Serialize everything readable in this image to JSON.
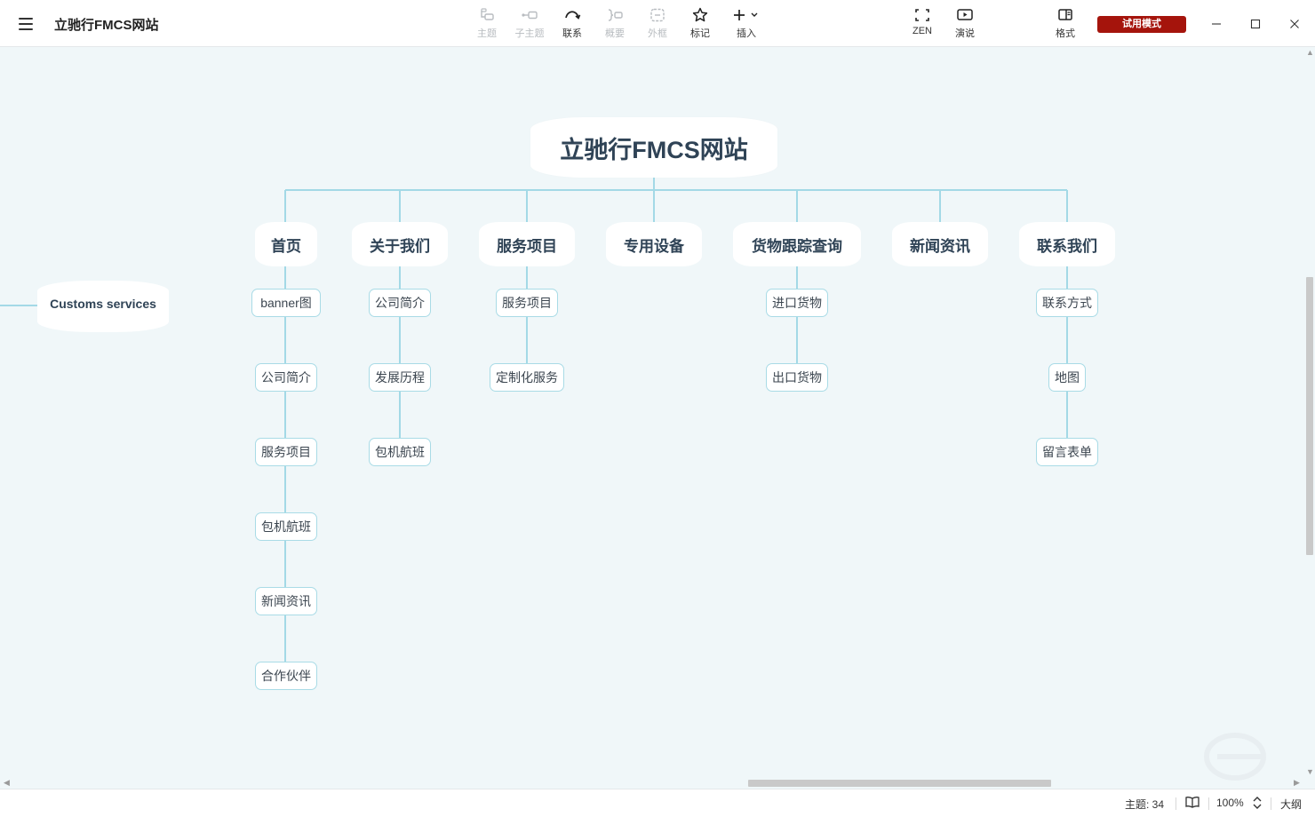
{
  "app": {
    "title": "立驰行FMCS网站",
    "trial_label": "试用模式"
  },
  "toolbar": {
    "tools": [
      {
        "label": "主题",
        "icon": "topic-icon",
        "enabled": false
      },
      {
        "label": "子主题",
        "icon": "subtopic-icon",
        "enabled": false
      },
      {
        "label": "联系",
        "icon": "relationship-icon",
        "enabled": true
      },
      {
        "label": "概要",
        "icon": "summary-icon",
        "enabled": false
      },
      {
        "label": "外框",
        "icon": "boundary-icon",
        "enabled": false
      },
      {
        "label": "标记",
        "icon": "star-icon",
        "enabled": true
      },
      {
        "label": "插入",
        "icon": "plus-icon",
        "enabled": true
      },
      {
        "label": "ZEN",
        "icon": "fullscreen-icon",
        "enabled": true
      },
      {
        "label": "演说",
        "icon": "play-icon",
        "enabled": true
      },
      {
        "label": "格式",
        "icon": "panel-icon",
        "enabled": true
      }
    ]
  },
  "mindmap": {
    "root": "立驰行FMCS网站",
    "branches": [
      {
        "label": "首页",
        "children": [
          "banner图",
          "公司简介",
          "服务项目",
          "包机航班",
          "新闻资讯",
          "合作伙伴"
        ]
      },
      {
        "label": "关于我们",
        "children": [
          "公司简介",
          "发展历程",
          "包机航班"
        ]
      },
      {
        "label": "服务项目",
        "children": [
          "服务项目",
          "定制化服务"
        ]
      },
      {
        "label": "专用设备",
        "children": []
      },
      {
        "label": "货物跟踪查询",
        "children": [
          "进口货物",
          "出口货物"
        ]
      },
      {
        "label": "新闻资讯",
        "children": []
      },
      {
        "label": "联系我们",
        "children": [
          "联系方式",
          "地图",
          "留言表单"
        ]
      }
    ],
    "floating_topic": "Customs services"
  },
  "status": {
    "topic_count_label": "主题: 34",
    "zoom": "100%",
    "outline_label": "大纲"
  },
  "colors": {
    "canvas_bg": "#f0f7f9",
    "connector": "#a3d9e6",
    "node_text": "#2f4356",
    "trial_bg": "#a5140c"
  }
}
